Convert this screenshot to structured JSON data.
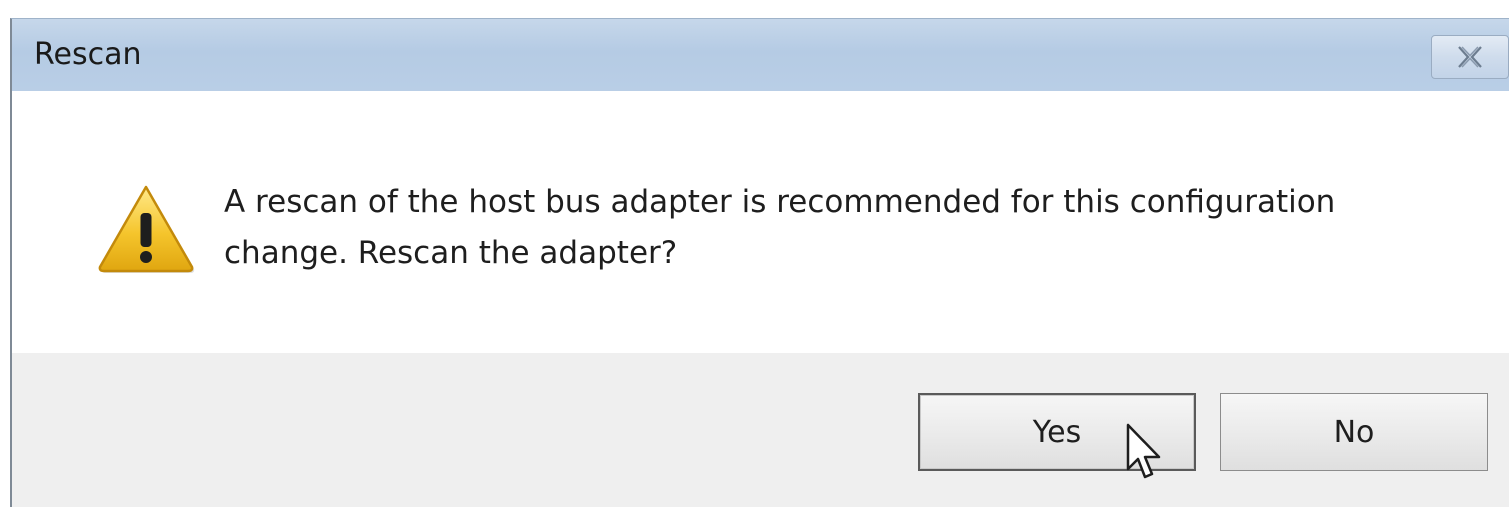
{
  "dialog": {
    "title": "Rescan",
    "close_icon": "close-icon",
    "warning_icon": "warning-icon",
    "message_line1": "A rescan of the host bus adapter is recommended for this configuration",
    "message_line2": "change. Rescan the adapter?",
    "buttons": {
      "yes_label": "Yes",
      "no_label": "No"
    }
  },
  "cursor_icon": "mouse-pointer-icon"
}
